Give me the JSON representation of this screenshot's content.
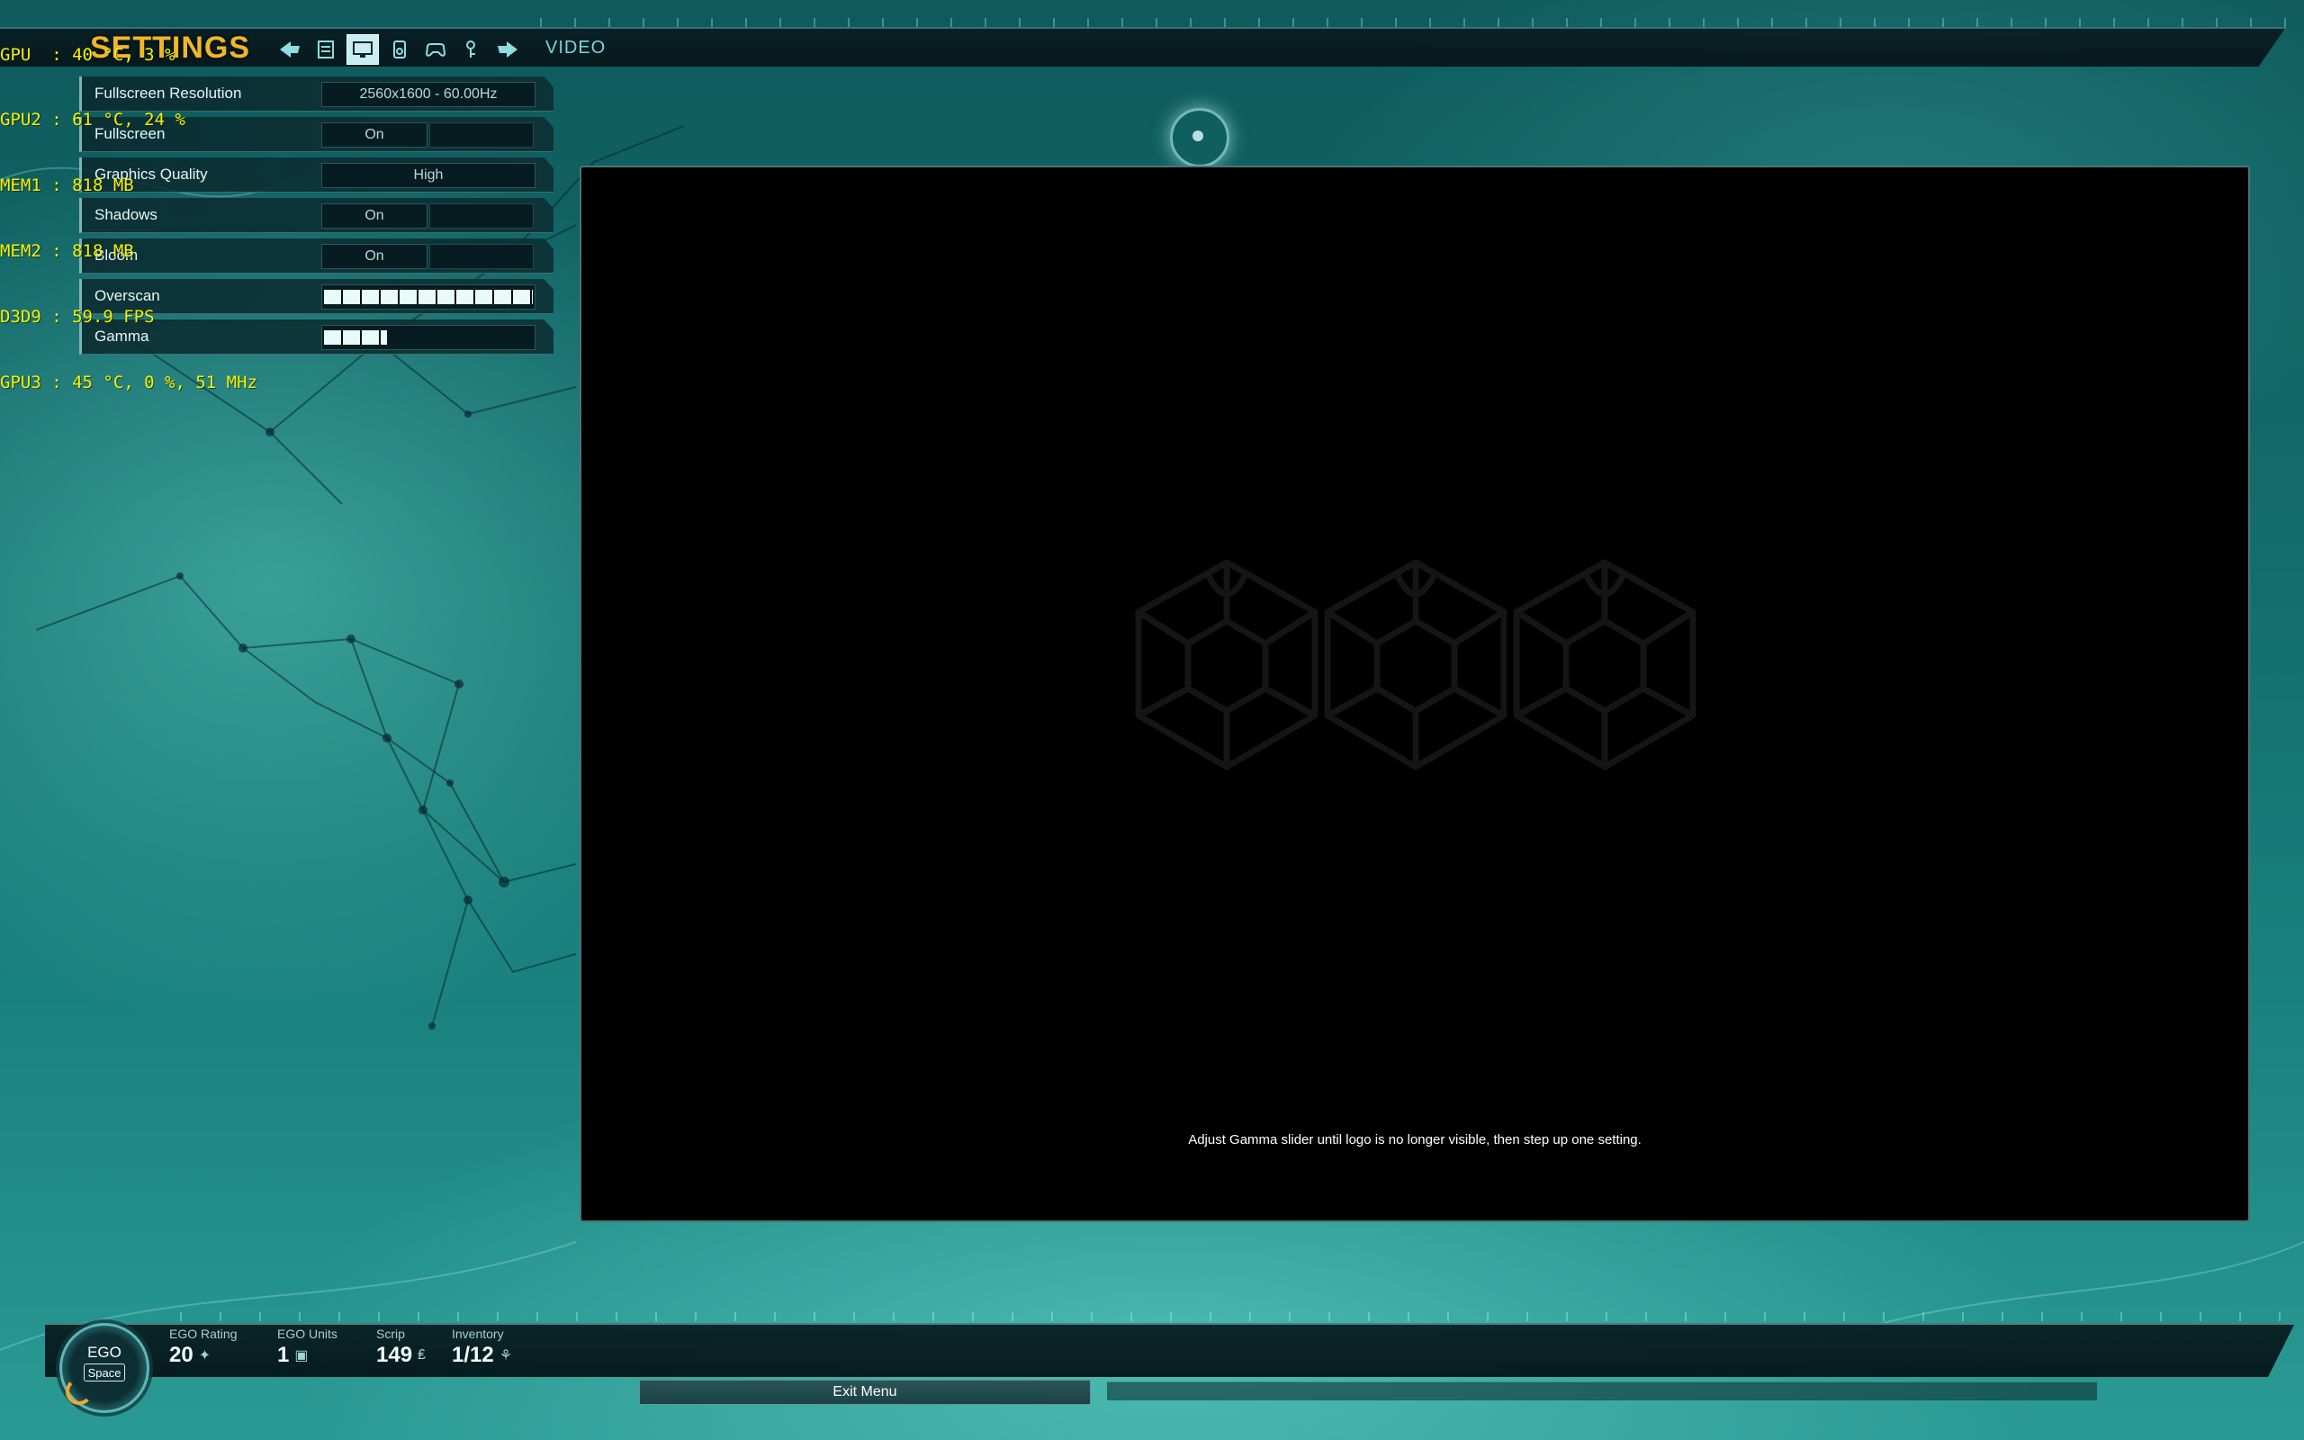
{
  "debug_overlay": {
    "lines": [
      "GPU  : 40 °C, 3 %",
      "GPU2 : 61 °C, 24 %",
      "MEM1 : 818 MB",
      "MEM2 : 818 MB",
      "D3D9 : 59.9 FPS",
      "GPU3 : 45 °C, 0 %, 51 MHz"
    ]
  },
  "header": {
    "title": "SETTINGS",
    "current_page": "VIDEO",
    "nav_icons": [
      "back-arrow-icon",
      "general-settings-icon",
      "video-monitor-icon",
      "audio-icon",
      "gamepad-icon",
      "keybind-icon",
      "forward-arrow-icon"
    ],
    "active_icon": "video-monitor-icon"
  },
  "settings": {
    "fullscreen_resolution": {
      "label": "Fullscreen Resolution",
      "value": "2560x1600 - 60.00Hz"
    },
    "fullscreen": {
      "label": "Fullscreen",
      "value": "On"
    },
    "graphics_quality": {
      "label": "Graphics Quality",
      "value": "High"
    },
    "shadows": {
      "label": "Shadows",
      "value": "On"
    },
    "bloom": {
      "label": "Bloom",
      "value": "On"
    },
    "overscan": {
      "label": "Overscan",
      "level": 1.0
    },
    "gamma": {
      "label": "Gamma",
      "level": 0.3
    }
  },
  "preview": {
    "hint": "Adjust Gamma slider until logo is no longer visible, then step up one setting."
  },
  "hud": {
    "ego_badge": {
      "label": "EGO",
      "key": "Space"
    },
    "ego_rating": {
      "label": "EGO Rating",
      "value": "20"
    },
    "ego_units": {
      "label": "EGO Units",
      "value": "1"
    },
    "scrip": {
      "label": "Scrip",
      "value": "149"
    },
    "inventory": {
      "label": "Inventory",
      "value": "1/12"
    },
    "exit_menu_label": "Exit Menu"
  },
  "colors": {
    "accent_gold": "#f0b62a",
    "debug_yellow": "#f6f100",
    "teal_text": "#7fd3d8"
  }
}
